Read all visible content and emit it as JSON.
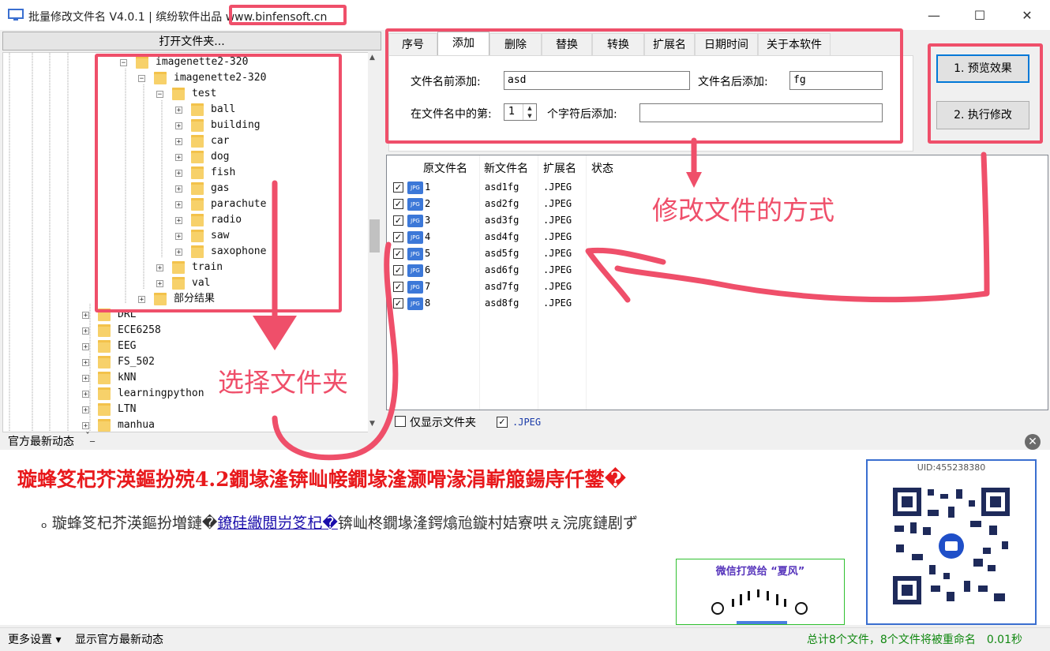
{
  "window": {
    "title": "批量修改文件名 V4.0.1 | 缤纷软件出品 ",
    "website": "www.binfensoft.cn",
    "minimize": "—",
    "maximize": "☐",
    "close": "✕"
  },
  "left": {
    "open_folder_button": "打开文件夹...",
    "tree": [
      {
        "label": "imagenette2-320",
        "expander": "−"
      },
      {
        "label": "imagenette2-320",
        "expander": "−"
      },
      {
        "label": "test",
        "expander": "−"
      },
      {
        "label": "ball",
        "expander": "+"
      },
      {
        "label": "building",
        "expander": "+"
      },
      {
        "label": "car",
        "expander": "+"
      },
      {
        "label": "dog",
        "expander": "+"
      },
      {
        "label": "fish",
        "expander": "+"
      },
      {
        "label": "gas",
        "expander": "+"
      },
      {
        "label": "parachute",
        "expander": "+"
      },
      {
        "label": "radio",
        "expander": "+"
      },
      {
        "label": "saw",
        "expander": "+"
      },
      {
        "label": "saxophone",
        "expander": "+"
      },
      {
        "label": "train",
        "expander": "+"
      },
      {
        "label": "val",
        "expander": "+"
      },
      {
        "label": "部分结果",
        "expander": "+"
      },
      {
        "label": "DRL",
        "expander": "+"
      },
      {
        "label": "ECE6258",
        "expander": "+"
      },
      {
        "label": "EEG",
        "expander": "+"
      },
      {
        "label": "FS_502",
        "expander": "+"
      },
      {
        "label": "kNN",
        "expander": "+"
      },
      {
        "label": "learningpython",
        "expander": "+"
      },
      {
        "label": "LTN",
        "expander": "+"
      },
      {
        "label": "manhua",
        "expander": "+"
      }
    ]
  },
  "tabs": [
    "序号",
    "添加",
    "删除",
    "替换",
    "转换",
    "扩展名",
    "日期时间",
    "关于本软件"
  ],
  "add_tab": {
    "prefix_label": "文件名前添加:",
    "prefix_value": "asd",
    "suffix_label": "文件名后添加:",
    "suffix_value": "fg",
    "pos_label": "在文件名中的第:",
    "pos_value": "1",
    "after_label": "个字符后添加:",
    "after_value": ""
  },
  "actions": {
    "preview": "1. 预览效果",
    "execute": "2. 执行修改"
  },
  "list": {
    "headers": [
      "原文件名",
      "新文件名",
      "扩展名",
      "状态"
    ],
    "rows": [
      {
        "orig": "1",
        "new": "asd1fg",
        "ext": ".JPEG",
        "status": ""
      },
      {
        "orig": "2",
        "new": "asd2fg",
        "ext": ".JPEG",
        "status": ""
      },
      {
        "orig": "3",
        "new": "asd3fg",
        "ext": ".JPEG",
        "status": ""
      },
      {
        "orig": "4",
        "new": "asd4fg",
        "ext": ".JPEG",
        "status": ""
      },
      {
        "orig": "5",
        "new": "asd5fg",
        "ext": ".JPEG",
        "status": ""
      },
      {
        "orig": "6",
        "new": "asd6fg",
        "ext": ".JPEG",
        "status": ""
      },
      {
        "orig": "7",
        "new": "asd7fg",
        "ext": ".JPEG",
        "status": ""
      },
      {
        "orig": "8",
        "new": "asd8fg",
        "ext": ".JPEG",
        "status": ""
      }
    ],
    "only_folders_label": "仅显示文件夹",
    "ext_filter_label": ".JPEG"
  },
  "news": {
    "label": "官方最新动态",
    "headline": "璇蜂笅杞芥渶鏂扮殑4.2鐗堟湰锛屾帹鐗堟湰灏嗗湪涓嶄箙鍚庤仟鐢�",
    "line_before": "璇蜂笅杞芥渶鏂扮増鏈�",
    "line_link": "鐐硅繖閲岃笅杞�",
    "line_after": "锛屾柊鐗堟湰鍔熻兘鏇村姞寮哄ぇ浣庣鏈剧ず",
    "qr_title": "微信打赏给 “夏风”",
    "uid": "UID:455238380"
  },
  "status": {
    "more_settings": "更多设置 ▾",
    "show_news": "显示官方最新动态",
    "summary": "总计8个文件，8个文件将被重命名　0.01秒"
  },
  "annotations": {
    "select_folder": "选择文件夹",
    "modify_method": "修改文件的方式"
  },
  "colors": {
    "annotation": "#ef4f6a",
    "headline": "#e8191c",
    "status_green": "#118811"
  }
}
